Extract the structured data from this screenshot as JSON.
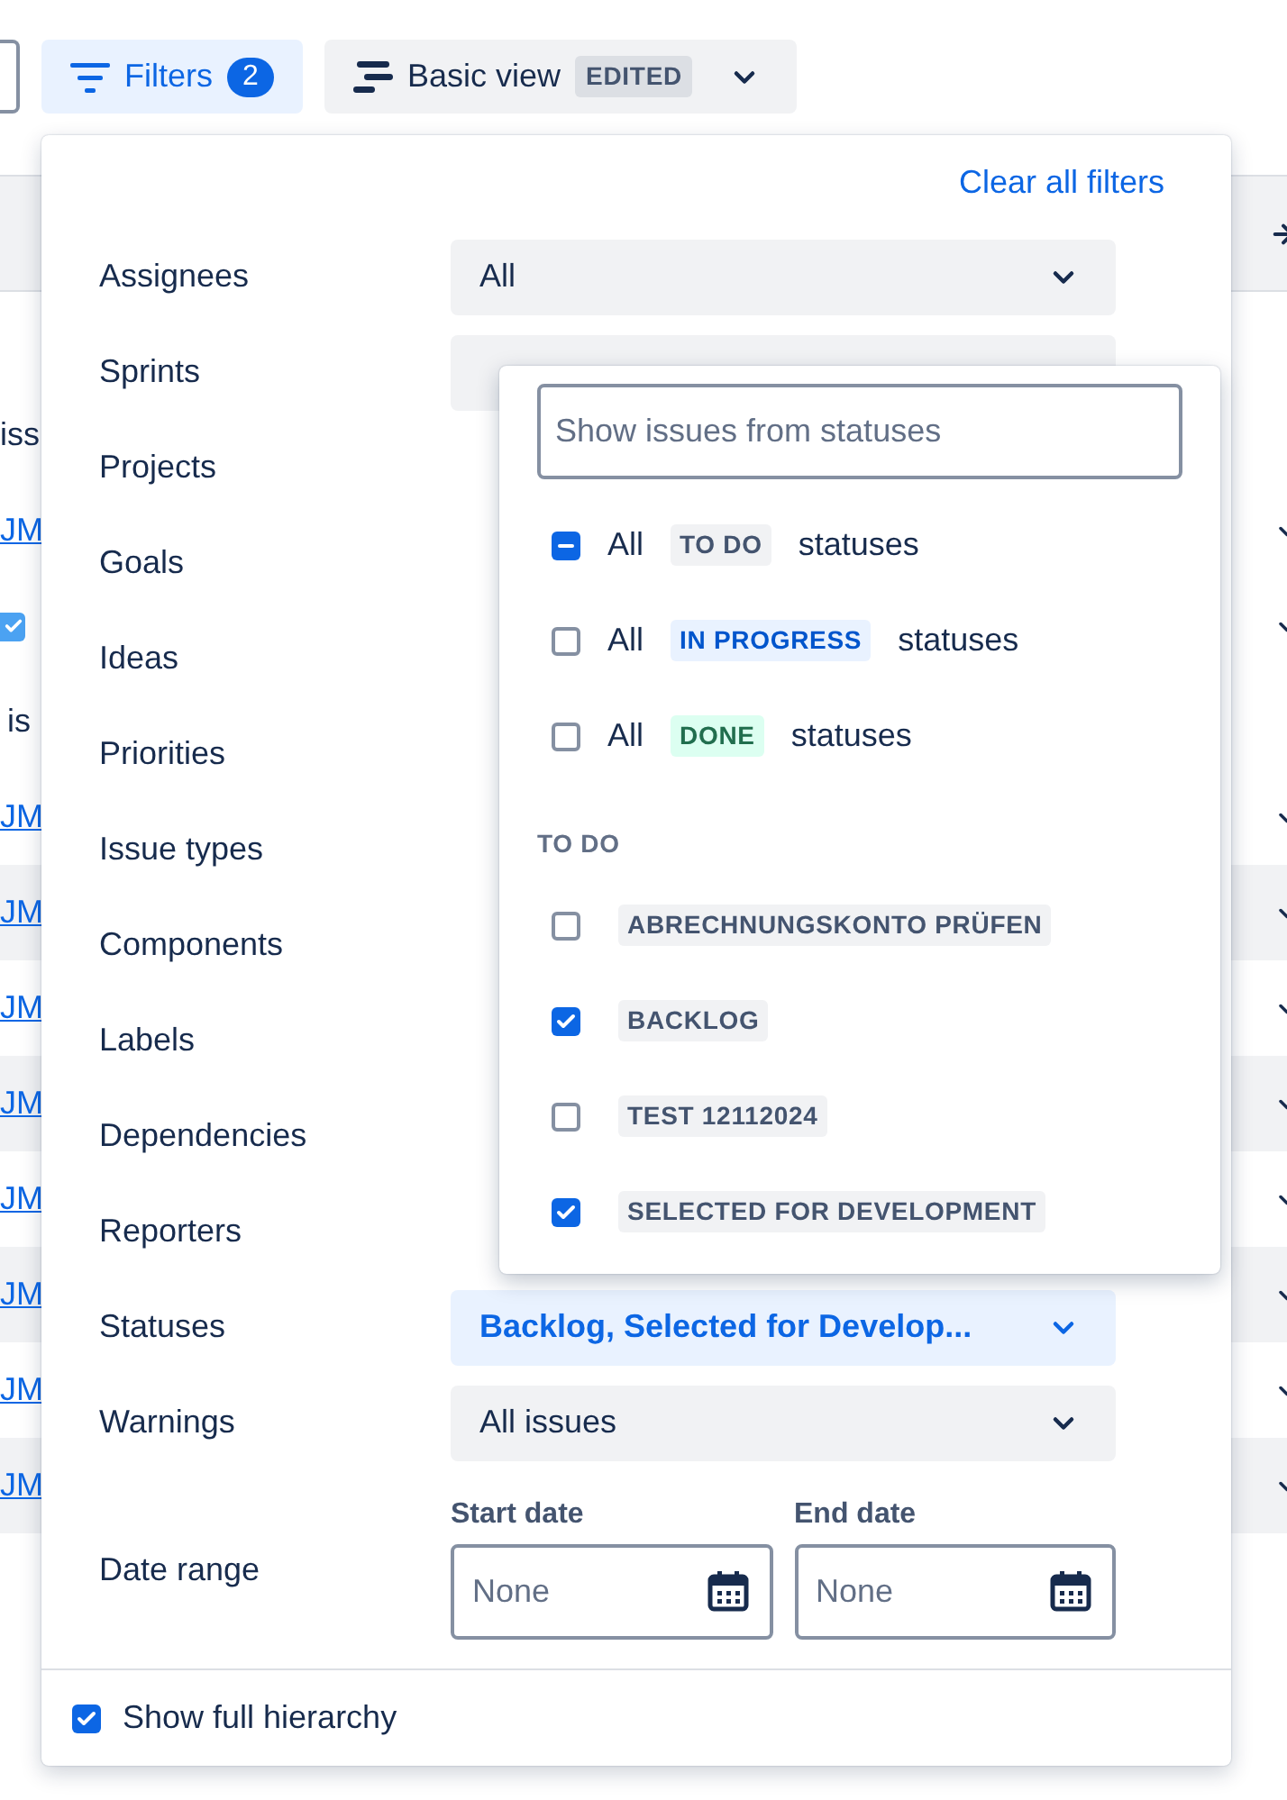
{
  "toolbar": {
    "filters_button": {
      "label": "Filters",
      "count": "2",
      "selected": true
    },
    "view_button": {
      "label": "Basic view",
      "badge": "EDITED"
    }
  },
  "background_rows": [
    {
      "kind": "group",
      "text": "iss",
      "shaded": false
    },
    {
      "kind": "item",
      "text": "JM",
      "shaded": false
    },
    {
      "kind": "checkbox",
      "checked": true,
      "shaded": false
    },
    {
      "kind": "group",
      "text": "is",
      "shaded": false
    },
    {
      "kind": "item",
      "text": "JM",
      "shaded": false
    },
    {
      "kind": "item",
      "text": "JM",
      "shaded": true
    },
    {
      "kind": "item",
      "text": "JM",
      "shaded": false
    },
    {
      "kind": "item",
      "text": "JM",
      "shaded": true
    },
    {
      "kind": "item",
      "text": "JM",
      "shaded": false
    },
    {
      "kind": "item",
      "text": "JM",
      "shaded": true
    },
    {
      "kind": "item",
      "text": "JM",
      "shaded": false
    },
    {
      "kind": "item",
      "text": "JM",
      "shaded": true
    }
  ],
  "filter_panel": {
    "clear_link": "Clear all filters",
    "filters": [
      {
        "label": "Assignees",
        "kind": "select",
        "value": "All",
        "active": false
      },
      {
        "label": "Sprints",
        "kind": "select"
      },
      {
        "label": "Projects",
        "kind": "covered"
      },
      {
        "label": "Goals",
        "kind": "covered"
      },
      {
        "label": "Ideas",
        "kind": "covered"
      },
      {
        "label": "Priorities",
        "kind": "covered"
      },
      {
        "label": "Issue types",
        "kind": "covered"
      },
      {
        "label": "Components",
        "kind": "covered"
      },
      {
        "label": "Labels",
        "kind": "covered"
      },
      {
        "label": "Dependencies",
        "kind": "covered"
      },
      {
        "label": "Reporters",
        "kind": "covered"
      },
      {
        "label": "Statuses",
        "kind": "select",
        "value": "Backlog, Selected for Develop...",
        "active": true
      },
      {
        "label": "Warnings",
        "kind": "select",
        "value": "All issues",
        "active": false
      }
    ],
    "date_range": {
      "label": "Date range",
      "start": {
        "label": "Start date",
        "placeholder": "None"
      },
      "end": {
        "label": "End date",
        "placeholder": "None"
      }
    },
    "footer": {
      "label": "Show full hierarchy",
      "checked": true
    }
  },
  "status_dropdown": {
    "search": {
      "placeholder": "Show issues from statuses"
    },
    "categories": [
      {
        "prefix": "All",
        "lozenge": "TO DO",
        "kind": "todo",
        "suffix": "statuses",
        "indeterminate": true
      },
      {
        "prefix": "All",
        "lozenge": "IN PROGRESS",
        "kind": "inprogress",
        "suffix": "statuses",
        "checked": false
      },
      {
        "prefix": "All",
        "lozenge": "DONE",
        "kind": "done",
        "suffix": "statuses",
        "checked": false
      }
    ],
    "section_label": "TO DO",
    "statuses": [
      {
        "label": "ABRECHNUNGSKONTO PRÜFEN",
        "checked": false
      },
      {
        "label": "BACKLOG",
        "checked": true
      },
      {
        "label": "TEST 12112024",
        "checked": false
      },
      {
        "label": "SELECTED FOR DEVELOPMENT",
        "checked": true
      }
    ]
  }
}
